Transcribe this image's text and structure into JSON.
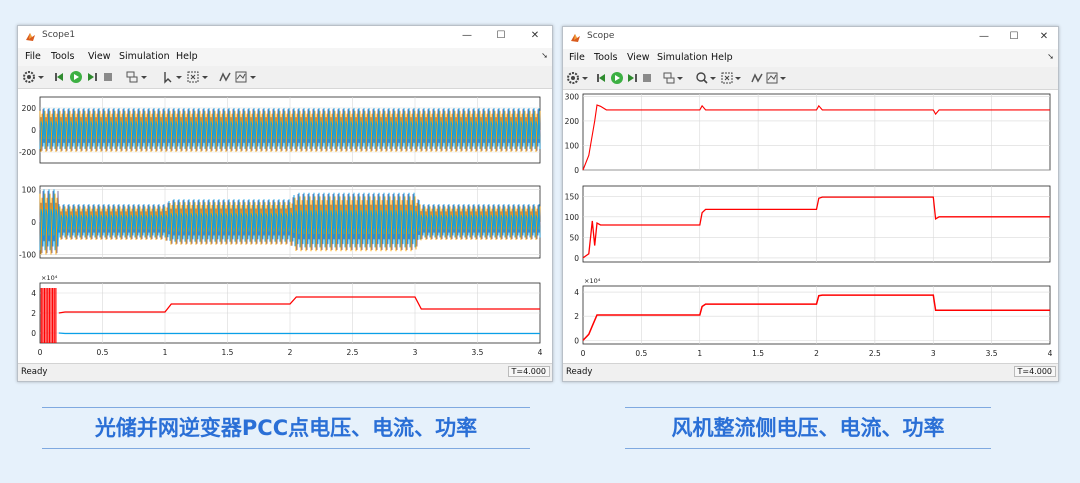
{
  "window1": {
    "title": "Scope1",
    "menu": [
      "File",
      "Tools",
      "View",
      "Simulation",
      "Help"
    ],
    "status": "Ready",
    "time_display": "T=4.000",
    "xticks": [
      "0",
      "0.5",
      "1",
      "1.5",
      "2",
      "2.5",
      "3",
      "3.5",
      "4"
    ],
    "panels": [
      {
        "yticks": [
          "200",
          "0",
          "-200"
        ],
        "exponent": ""
      },
      {
        "yticks": [
          "100",
          "0",
          "-100"
        ],
        "exponent": ""
      },
      {
        "yticks": [
          "4",
          "2",
          "0"
        ],
        "exponent": "×10⁴"
      }
    ]
  },
  "window2": {
    "title": "Scope",
    "menu": [
      "File",
      "Tools",
      "View",
      "Simulation",
      "Help"
    ],
    "status": "Ready",
    "time_display": "T=4.000",
    "xticks": [
      "0",
      "0.5",
      "1",
      "1.5",
      "2",
      "2.5",
      "3",
      "3.5",
      "4"
    ],
    "panels": [
      {
        "yticks": [
          "300",
          "200",
          "100",
          "0"
        ],
        "exponent": ""
      },
      {
        "yticks": [
          "150",
          "100",
          "50",
          "0"
        ],
        "exponent": ""
      },
      {
        "yticks": [
          "4",
          "2",
          "0"
        ],
        "exponent": "×10⁴"
      }
    ]
  },
  "captions": {
    "left": "光储并网逆变器PCC点电压、电流、功率",
    "right": "风机整流侧电压、电流、功率"
  },
  "colors": {
    "red": "#ff0000",
    "blue": "#0aa0e8",
    "orange": "#ffa500",
    "purple": "#7e6f9e",
    "caption": "#2a6fd6"
  },
  "chart_data": [
    {
      "type": "line",
      "title": "",
      "xlim": [
        0,
        4
      ],
      "ylim": [
        -300,
        300
      ],
      "description_series": [
        {
          "values_envelope": [
            [
              0,
              200
            ],
            [
              4,
              200
            ]
          ],
          "note_amplitude": 200
        }
      ]
    },
    {
      "type": "line",
      "xlim": [
        0,
        4
      ],
      "ylim": [
        -100,
        100
      ],
      "envelope": [
        [
          0.15,
          55
        ],
        [
          1.0,
          55
        ],
        [
          1.05,
          70
        ],
        [
          2.0,
          70
        ],
        [
          2.05,
          90
        ],
        [
          3.0,
          90
        ],
        [
          3.05,
          55
        ],
        [
          4.0,
          55
        ]
      ]
    },
    {
      "type": "line",
      "xlim": [
        0,
        4
      ],
      "ylim": [
        -10000,
        50000
      ],
      "series": [
        {
          "x": [
            0.15,
            0.2,
            1.0,
            1.05,
            2.0,
            2.05,
            3.0,
            3.05,
            4.0
          ],
          "y": [
            20000,
            21000,
            21000,
            29000,
            29000,
            36000,
            36000,
            24000,
            24000
          ]
        },
        {
          "x": [
            0.15,
            0.2,
            4.0
          ],
          "y": [
            0,
            -500,
            -500
          ]
        }
      ]
    },
    {
      "type": "line",
      "xlim": [
        0,
        4
      ],
      "ylim": [
        0,
        300
      ],
      "series": [
        {
          "x": [
            0,
            0.05,
            0.1,
            0.12,
            0.15,
            0.2,
            1.0,
            1.02,
            1.05,
            2.0,
            2.02,
            2.05,
            3.0,
            3.02,
            3.05,
            4.0
          ],
          "y": [
            0,
            60,
            200,
            265,
            260,
            245,
            245,
            262,
            245,
            245,
            262,
            245,
            245,
            228,
            245,
            245
          ]
        }
      ]
    },
    {
      "type": "line",
      "xlim": [
        0,
        4
      ],
      "ylim": [
        0,
        175
      ],
      "series": [
        {
          "x": [
            0,
            0.05,
            0.08,
            0.1,
            0.12,
            0.15,
            0.2,
            1.0,
            1.02,
            1.05,
            2.0,
            2.02,
            2.05,
            3.0,
            3.02,
            3.05,
            4.0
          ],
          "y": [
            0,
            10,
            90,
            30,
            85,
            80,
            80,
            80,
            110,
            118,
            118,
            145,
            148,
            148,
            95,
            100,
            100
          ]
        }
      ]
    },
    {
      "type": "line",
      "xlim": [
        0,
        4
      ],
      "ylim": [
        0,
        45000
      ],
      "series": [
        {
          "x": [
            0,
            0.05,
            0.08,
            0.12,
            0.15,
            0.2,
            1.0,
            1.02,
            1.05,
            2.0,
            2.02,
            2.05,
            3.0,
            3.02,
            3.05,
            4.0
          ],
          "y": [
            0,
            5000,
            12000,
            21000,
            21000,
            21000,
            21000,
            28000,
            30000,
            30000,
            37000,
            37500,
            37500,
            25000,
            25000,
            25000
          ]
        }
      ]
    }
  ]
}
